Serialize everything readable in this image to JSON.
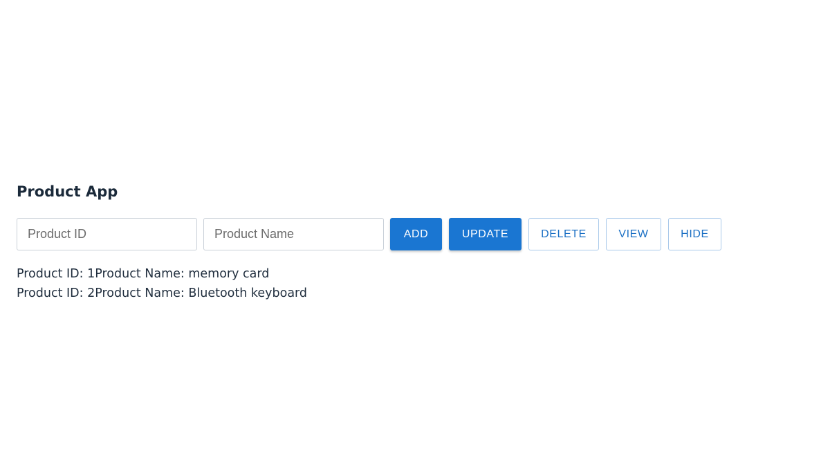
{
  "app": {
    "title": "Product App"
  },
  "form": {
    "product_id": {
      "value": "",
      "placeholder": "Product ID"
    },
    "product_name": {
      "value": "",
      "placeholder": "Product Name"
    }
  },
  "buttons": {
    "add": "ADD",
    "update": "UPDATE",
    "delete": "DELETE",
    "view": "VIEW",
    "hide": "HIDE"
  },
  "products": [
    {
      "id_label": "Product ID: ",
      "id": "1",
      "name_label": "Product Name: ",
      "name": "memory card"
    },
    {
      "id_label": "Product ID: ",
      "id": "2",
      "name_label": "Product Name: ",
      "name": "Bluetooth keyboard"
    }
  ],
  "colors": {
    "primary": "#1a76d2",
    "outline_text": "#1a6fc4",
    "outline_border": "#a9c9ea",
    "text": "#1f2d3d"
  }
}
